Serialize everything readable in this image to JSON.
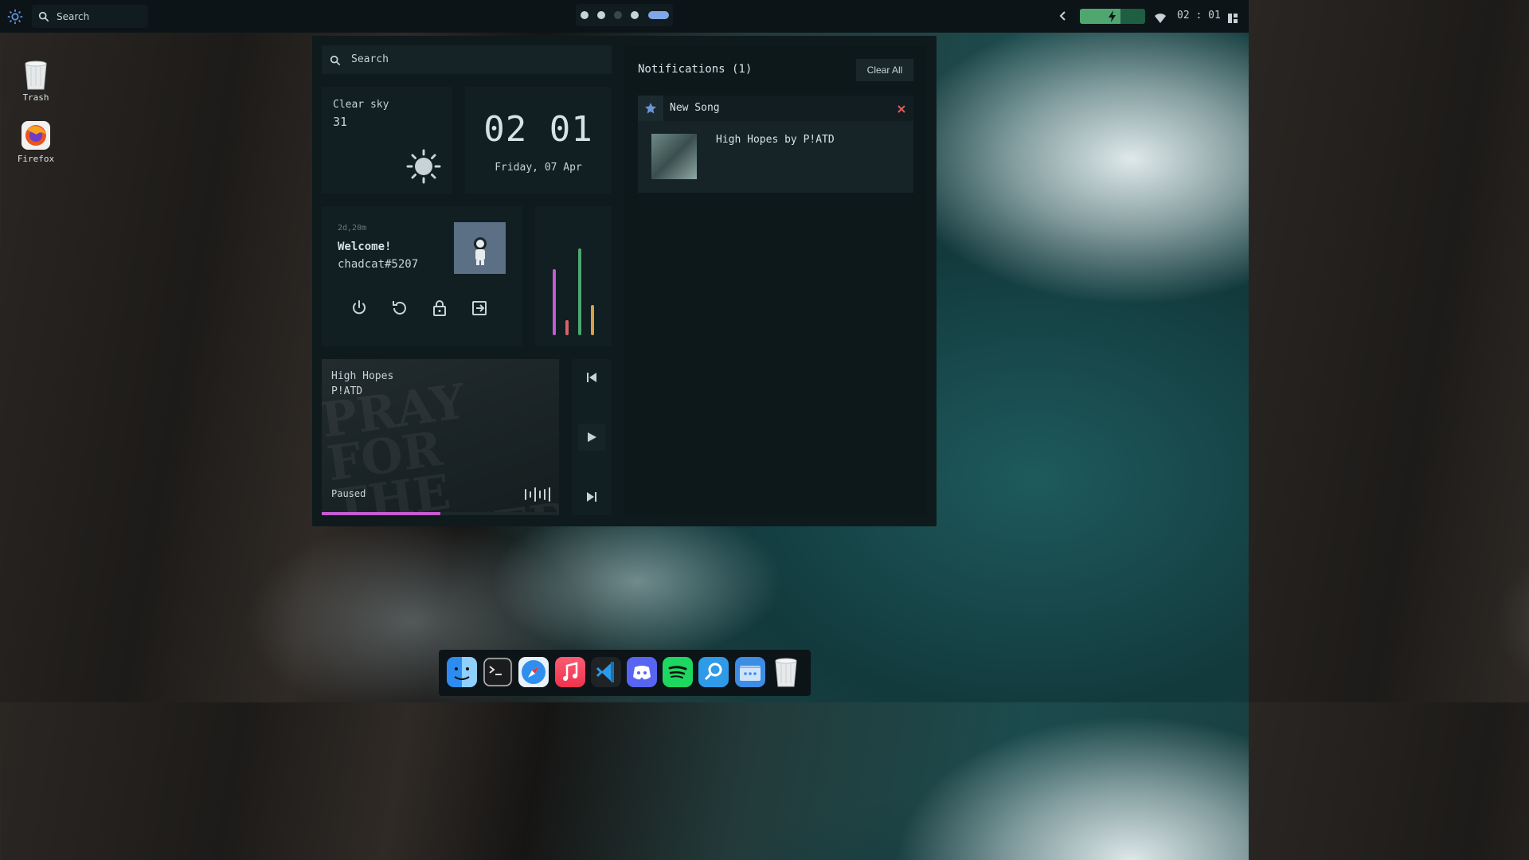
{
  "topbar": {
    "search_placeholder": "Search",
    "clock": "02 : 01",
    "battery_level": 0.62,
    "workspaces": [
      {
        "state": "occupied"
      },
      {
        "state": "occupied"
      },
      {
        "state": "empty"
      },
      {
        "state": "occupied"
      },
      {
        "state": "active"
      }
    ]
  },
  "desktop": {
    "icons": [
      {
        "label": "Trash",
        "icon": "trash-icon"
      },
      {
        "label": "Firefox",
        "icon": "firefox-icon"
      }
    ]
  },
  "panel": {
    "search_placeholder": "Search",
    "weather": {
      "condition": "Clear sky",
      "temperature": "31",
      "icon": "sun-icon"
    },
    "clock": {
      "time": "02 01",
      "date": "Friday, 07 Apr"
    },
    "profile": {
      "uptime": "2d,20m",
      "greeting": "Welcome!",
      "username": "chadcat#5207",
      "buttons": [
        "power-icon",
        "restart-icon",
        "lock-icon",
        "logout-icon"
      ]
    },
    "system_bars": [
      {
        "value": 0.52,
        "color": "#c45bd0"
      },
      {
        "value": 0.12,
        "color": "#d9616b"
      },
      {
        "value": 0.68,
        "color": "#4fa66e"
      },
      {
        "value": 0.24,
        "color": "#d8a047"
      }
    ],
    "music": {
      "title": "High Hopes",
      "artist": "P!ATD",
      "status": "Paused",
      "progress": 0.5,
      "accent": "#c45bd0"
    },
    "notifications": {
      "header": "Notifications (1)",
      "clear_label": "Clear All",
      "items": [
        {
          "app_icon": "star-icon",
          "title": "New Song",
          "body": "High Hopes by P!ATD"
        }
      ]
    }
  },
  "dock": {
    "apps": [
      "finder-icon",
      "terminal-icon",
      "safari-icon",
      "music-icon",
      "vscode-icon",
      "discord-icon",
      "spotify-icon",
      "search-app-icon",
      "files-icon",
      "trash-icon"
    ]
  }
}
